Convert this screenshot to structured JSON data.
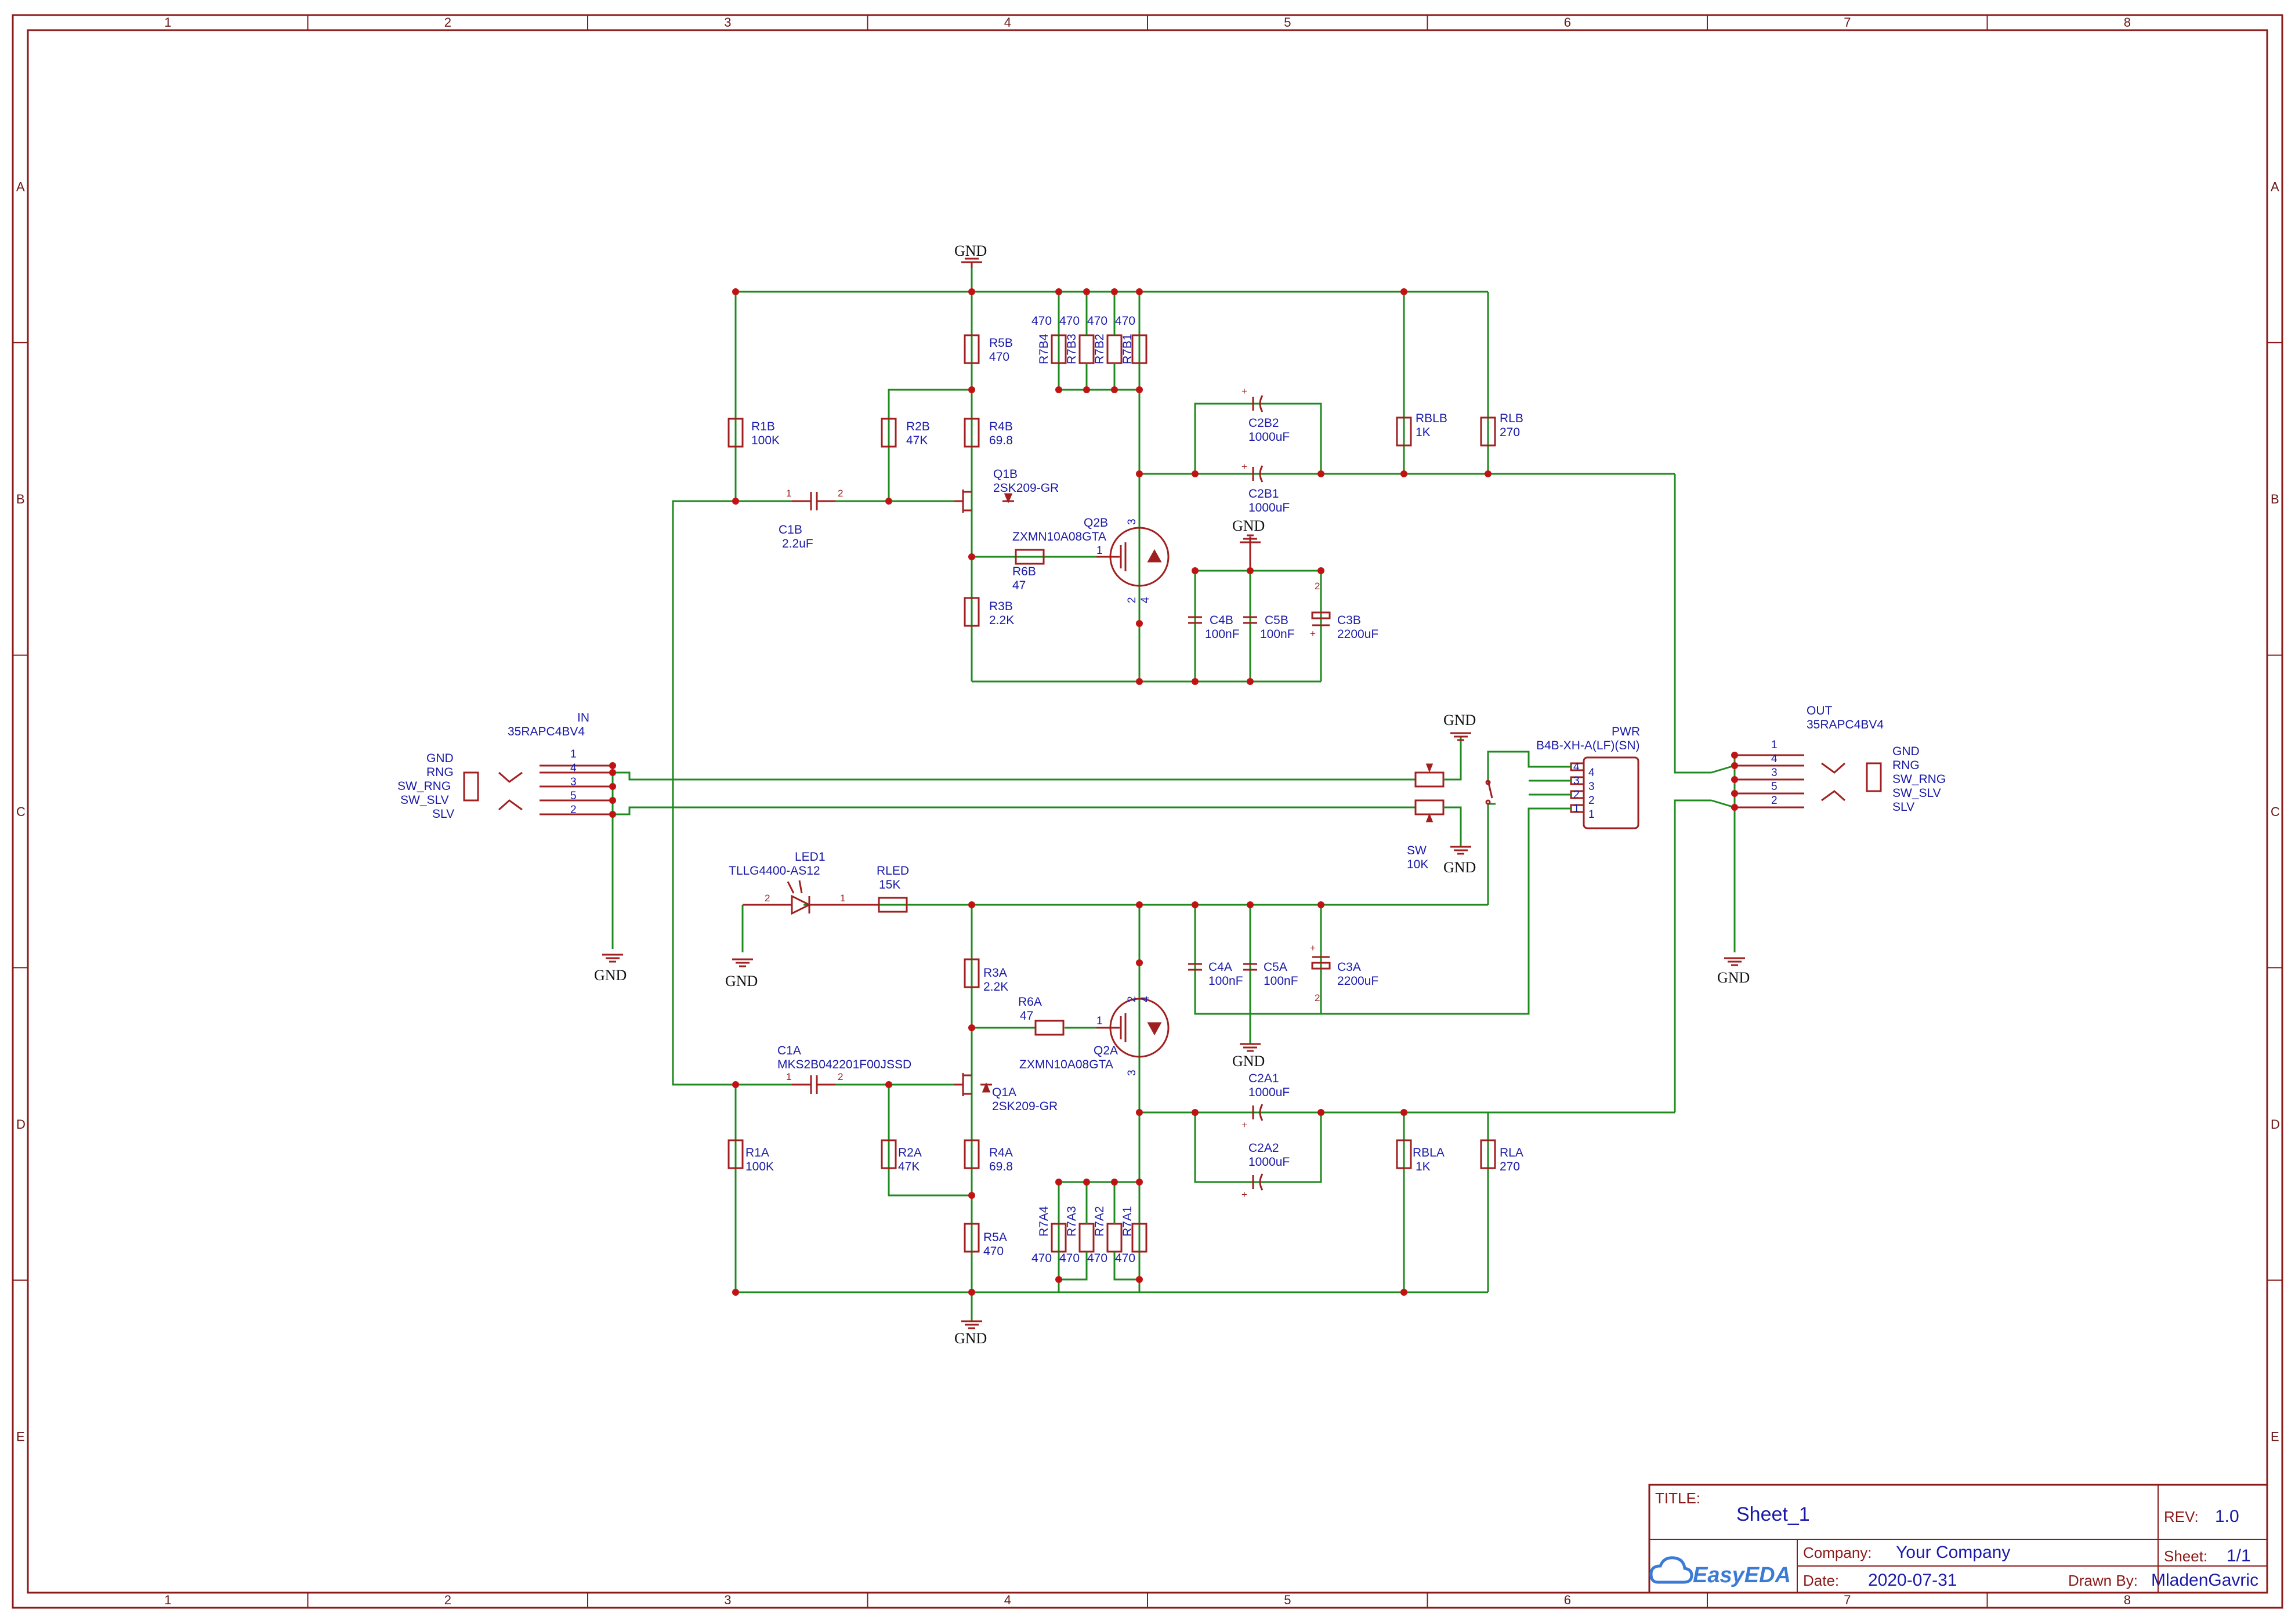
{
  "sheet": {
    "columns": [
      "1",
      "2",
      "3",
      "4",
      "5",
      "6",
      "7",
      "8"
    ],
    "rows": [
      "A",
      "B",
      "C",
      "D",
      "E"
    ]
  },
  "title_block": {
    "title_label": "TITLE:",
    "title": "Sheet_1",
    "rev_label": "REV:",
    "rev": "1.0",
    "company_label": "Company:",
    "company": "Your Company",
    "sheet_label": "Sheet:",
    "sheet": "1/1",
    "date_label": "Date:",
    "date": "2020-07-31",
    "drawn_label": "Drawn By:",
    "drawn_by": "MladenGavric",
    "logo": "EasyEDA",
    "logo_icon": "cloud-car-icon"
  },
  "net_labels": {
    "gnd": "GND"
  },
  "in_jack": {
    "name": "IN",
    "part": "35RAPC4BV4",
    "signals": [
      "GND",
      "RNG",
      "SW_RNG",
      "SW_SLV",
      "SLV"
    ],
    "pins": [
      "1",
      "4",
      "3",
      "5",
      "2"
    ]
  },
  "out_jack": {
    "name": "OUT",
    "part": "35RAPC4BV4",
    "signals": [
      "GND",
      "RNG",
      "SW_RNG",
      "SW_SLV",
      "SLV"
    ],
    "pins": [
      "1",
      "4",
      "3",
      "5",
      "2"
    ]
  },
  "pwr": {
    "name": "PWR",
    "part": "B4B-XH-A(LF)(SN)",
    "pins": [
      "4",
      "3",
      "2",
      "1"
    ]
  },
  "sw": {
    "name": "SW",
    "value": "10K"
  },
  "channel_b": {
    "r1": {
      "ref": "R1B",
      "val": "100K"
    },
    "r2": {
      "ref": "R2B",
      "val": "47K"
    },
    "r3": {
      "ref": "R3B",
      "val": "2.2K"
    },
    "r4": {
      "ref": "R4B",
      "val": "69.8"
    },
    "r5": {
      "ref": "R5B",
      "val": "470"
    },
    "r6": {
      "ref": "R6B",
      "val": "47"
    },
    "r7": [
      {
        "ref": "R7B4",
        "val": "470"
      },
      {
        "ref": "R7B3",
        "val": "470"
      },
      {
        "ref": "R7B2",
        "val": "470"
      },
      {
        "ref": "R7B1",
        "val": "470"
      }
    ],
    "rb": {
      "ref": "RBLB",
      "val": "1K"
    },
    "rl": {
      "ref": "RLB",
      "val": "270"
    },
    "c1": {
      "ref": "C1B",
      "val": "2.2uF"
    },
    "c2a": {
      "ref": "C2B2",
      "val": "1000uF"
    },
    "c2b": {
      "ref": "C2B1",
      "val": "1000uF"
    },
    "c3": {
      "ref": "C3B",
      "val": "2200uF"
    },
    "c4": {
      "ref": "C4B",
      "val": "100nF"
    },
    "c5": {
      "ref": "C5B",
      "val": "100nF"
    },
    "q1": {
      "ref": "Q1B",
      "val": "2SK209-GR"
    },
    "q2": {
      "ref": "Q2B",
      "val": "ZXMN10A08GTA"
    }
  },
  "channel_a": {
    "r1": {
      "ref": "R1A",
      "val": "100K"
    },
    "r2": {
      "ref": "R2A",
      "val": "47K"
    },
    "r3": {
      "ref": "R3A",
      "val": "2.2K"
    },
    "r4": {
      "ref": "R4A",
      "val": "69.8"
    },
    "r5": {
      "ref": "R5A",
      "val": "470"
    },
    "r6": {
      "ref": "R6A",
      "val": "47"
    },
    "r7": [
      {
        "ref": "R7A4",
        "val": "470"
      },
      {
        "ref": "R7A3",
        "val": "470"
      },
      {
        "ref": "R7A2",
        "val": "470"
      },
      {
        "ref": "R7A1",
        "val": "470"
      }
    ],
    "rb": {
      "ref": "RBLA",
      "val": "1K"
    },
    "rl": {
      "ref": "RLA",
      "val": "270"
    },
    "c1": {
      "ref": "C1A",
      "val": "MKS2B042201F00JSSD"
    },
    "c2a": {
      "ref": "C2A1",
      "val": "1000uF"
    },
    "c2b": {
      "ref": "C2A2",
      "val": "1000uF"
    },
    "c3": {
      "ref": "C3A",
      "val": "2200uF"
    },
    "c4": {
      "ref": "C4A",
      "val": "100nF"
    },
    "c5": {
      "ref": "C5A",
      "val": "100nF"
    },
    "q1": {
      "ref": "Q1A",
      "val": "2SK209-GR"
    },
    "q2": {
      "ref": "Q2A",
      "val": "ZXMN10A08GTA"
    }
  },
  "led": {
    "led": {
      "ref": "LED1",
      "val": "TLLG4400-AS12"
    },
    "rled": {
      "ref": "RLED",
      "val": "15K"
    }
  },
  "mosfet_pins": {
    "g": "1",
    "d": "3",
    "s": "2",
    "t": "4"
  },
  "cap_pins": {
    "p1": "1",
    "p2": "2",
    "plus": "+"
  }
}
